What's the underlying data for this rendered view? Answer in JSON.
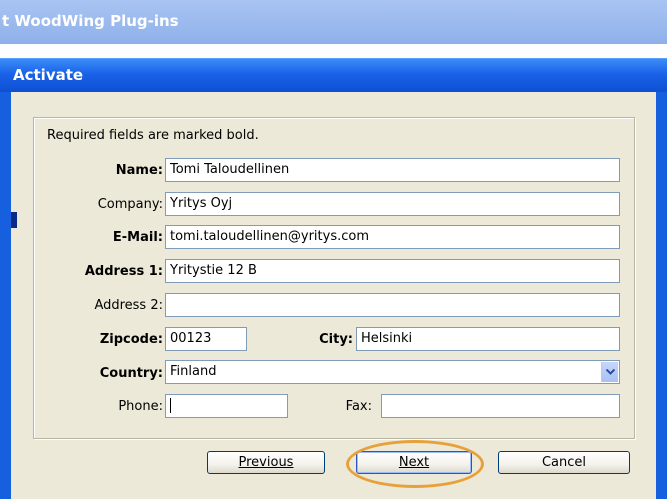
{
  "outer_window": {
    "title": "t WoodWing Plug-ins"
  },
  "dialog": {
    "title": "Activate"
  },
  "form": {
    "hint": "Required fields are marked bold.",
    "name": {
      "label": "Name:",
      "value": "Tomi Taloudellinen"
    },
    "company": {
      "label": "Company:",
      "value": "Yritys Oyj"
    },
    "email": {
      "label": "E-Mail:",
      "value": "tomi.taloudellinen@yritys.com"
    },
    "address1": {
      "label": "Address 1:",
      "value": "Yritystie 12 B"
    },
    "address2": {
      "label": "Address 2:",
      "value": ""
    },
    "zipcode": {
      "label": "Zipcode:",
      "value": "00123"
    },
    "city": {
      "label": "City:",
      "value": "Helsinki"
    },
    "country": {
      "label": "Country:",
      "value": "Finland"
    },
    "phone": {
      "label": "Phone:",
      "value": ""
    },
    "fax": {
      "label": "Fax:",
      "value": ""
    }
  },
  "buttons": {
    "previous": "Previous",
    "next": "Next",
    "cancel": "Cancel"
  },
  "colors": {
    "highlight_ring": "#e8a13a",
    "titlebar": "#1a62e8"
  }
}
